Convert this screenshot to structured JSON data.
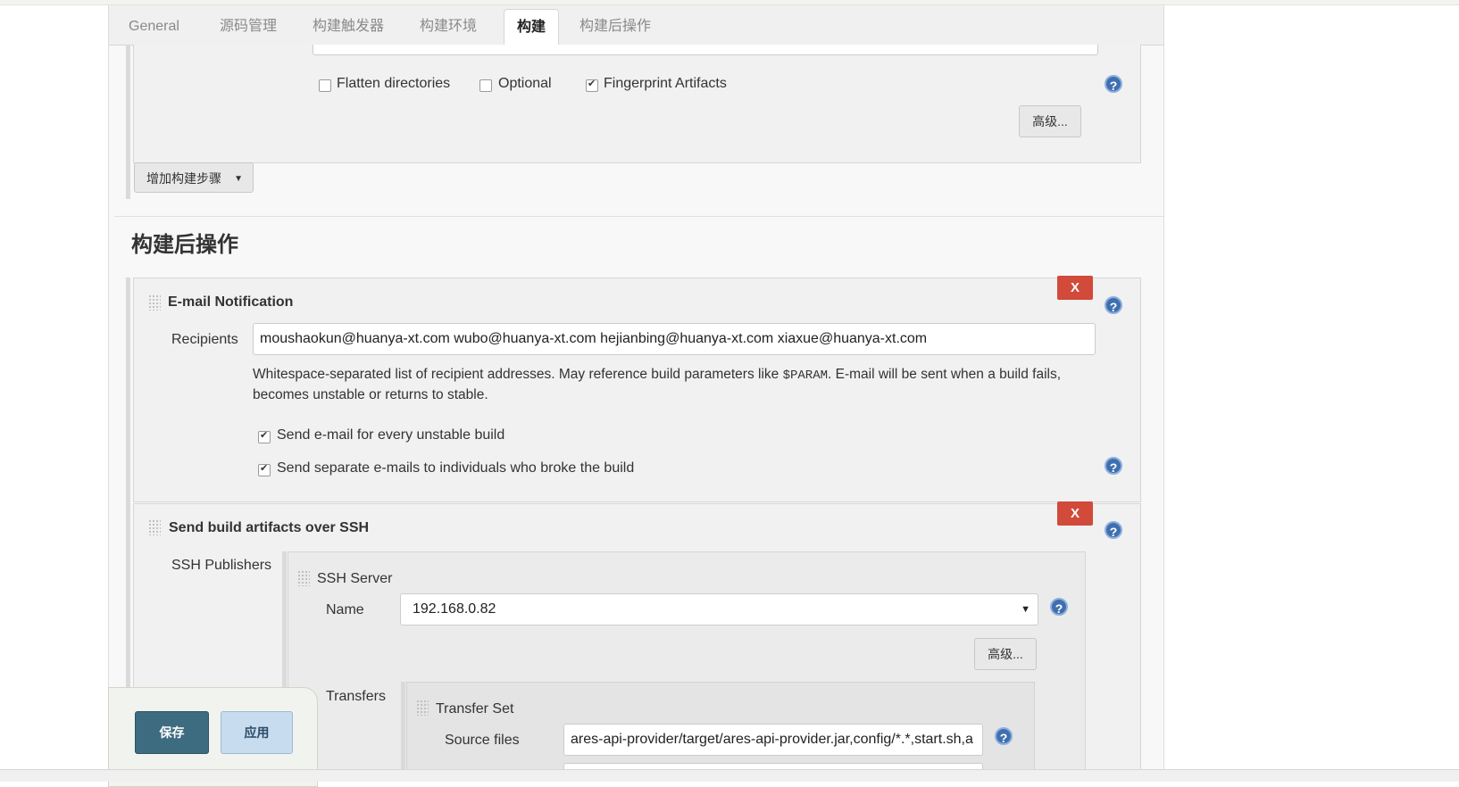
{
  "tabs": [
    "General",
    "源码管理",
    "构建触发器",
    "构建环境",
    "构建",
    "构建后操作"
  ],
  "active_tab": "构建",
  "archive": {
    "flatten_label": "Flatten directories",
    "flatten_checked": false,
    "optional_label": "Optional",
    "optional_checked": false,
    "fingerprint_label": "Fingerprint Artifacts",
    "fingerprint_checked": true,
    "advanced_label": "高级..."
  },
  "add_step_label": "增加构建步骤",
  "post_build_title": "构建后操作",
  "email": {
    "title": "E-mail Notification",
    "delete_label": "X",
    "recipients_label": "Recipients",
    "recipients_value": "moushaokun@huanya-xt.com wubo@huanya-xt.com hejianbing@huanya-xt.com xiaxue@huanya-xt.com",
    "desc_pre": "Whitespace-separated list of recipient addresses. May reference build parameters like ",
    "desc_code": "$PARAM",
    "desc_post": ". E-mail will be sent when a build fails, becomes unstable or returns to stable.",
    "unstable_label": "Send e-mail for every unstable build",
    "unstable_checked": true,
    "separate_label": "Send separate e-mails to individuals who broke the build",
    "separate_checked": true
  },
  "ssh": {
    "title": "Send build artifacts over SSH",
    "delete_label": "X",
    "publishers_label": "SSH Publishers",
    "server_title": "SSH Server",
    "name_label": "Name",
    "name_value": "192.168.0.82",
    "advanced_label": "高级...",
    "transfers_label": "Transfers",
    "transfer_set_title": "Transfer Set",
    "source_files_label": "Source files",
    "source_files_value": "ares-api-provider/target/ares-api-provider.jar,config/*.*,start.sh,a"
  },
  "save_label": "保存",
  "apply_label": "应用",
  "colors": {
    "primary_button": "#3d6b80",
    "apply_button": "#c8dcef",
    "delete_button": "#d24a3a",
    "help_icon": "#3f6fb0"
  }
}
